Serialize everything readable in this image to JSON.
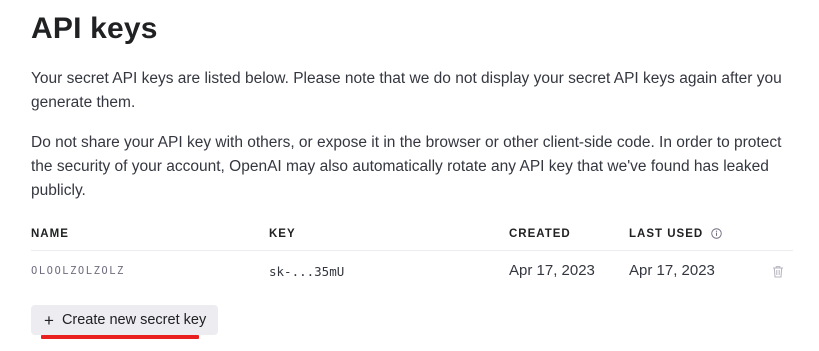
{
  "page": {
    "title": "API keys",
    "paragraph_1": "Your secret API keys are listed below. Please note that we do not display your secret API keys again after you generate them.",
    "paragraph_2": "Do not share your API key with others, or expose it in the browser or other client-side code. In order to protect the security of your account, OpenAI may also automatically rotate any API key that we've found has leaked publicly."
  },
  "table": {
    "headers": {
      "name": "NAME",
      "key": "KEY",
      "created": "CREATED",
      "last_used": "LAST USED"
    },
    "rows": [
      {
        "name": "OLOOLZOLZOLZ",
        "key": "sk-...35mU",
        "created": "Apr 17, 2023",
        "last_used": "Apr 17, 2023"
      }
    ]
  },
  "actions": {
    "create_label": "Create new secret key",
    "create_icon": "+"
  },
  "icons": {
    "info": "info-icon",
    "delete": "trash-icon"
  },
  "colors": {
    "button_bg": "#ececf1",
    "annotation_underline": "#e8201f",
    "text": "#202123"
  }
}
